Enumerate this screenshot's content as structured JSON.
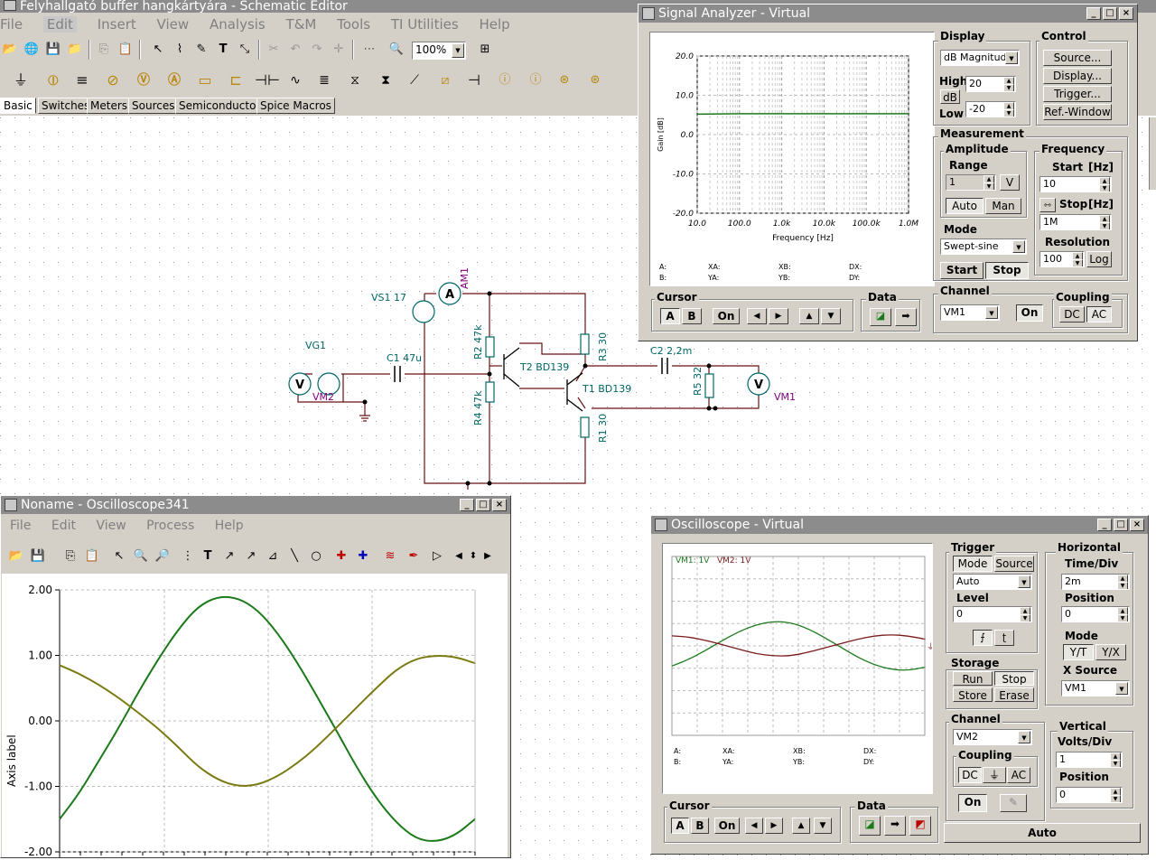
{
  "main": {
    "title": "Felyhallgató buffer hangkártyára - Schematic Editor",
    "menu": [
      "File",
      "Edit",
      "Insert",
      "View",
      "Analysis",
      "T&M",
      "Tools",
      "TI Utilities",
      "Help"
    ],
    "zoom": "100%",
    "tabs": [
      "Basic",
      "Switches",
      "Meters",
      "Sources",
      "Semiconductors",
      "Spice Macros"
    ]
  },
  "schematic": {
    "labels": {
      "vs1": "VS1 17",
      "am1": "AM1",
      "vg1": "VG1",
      "vm2": "VM2",
      "c1": "C1 47u",
      "r2": "R2 47k",
      "r4": "R4 47k",
      "t2": "T2 BD139",
      "t1": "T1 BD139",
      "r3": "R3 30",
      "r1": "R1 30",
      "c2": "C2 2,2m",
      "r5": "R5 32",
      "vm1": "VM1"
    }
  },
  "signal_analyzer": {
    "title": "Signal Analyzer - Virtual",
    "display_group": "Display",
    "display_mode": "dB Magnitude",
    "high_label": "High",
    "db_button": "dB",
    "low_label": "Low",
    "high_value": "20",
    "low_value": "-20",
    "control_group": "Control",
    "control_buttons": [
      "Source...",
      "Display...",
      "Trigger...",
      "Ref.-Window"
    ],
    "measurement_group": "Measurement",
    "amplitude_group": "Amplitude",
    "range_label": "Range",
    "range_value": "1",
    "range_unit": "V",
    "auto_btn": "Auto",
    "man_btn": "Man",
    "frequency_group": "Frequency",
    "start_label": "Start",
    "start_unit": "[Hz]",
    "start_value": "10",
    "stop_label": "Stop",
    "stop_unit": "[Hz]",
    "stop_value": "1M",
    "resolution_label": "Resolution",
    "resolution_value": "100",
    "log_btn": "Log",
    "mode_label": "Mode",
    "mode_value": "Swept-sine",
    "start_btn": "Start",
    "stop_btn": "Stop",
    "cursor_group": "Cursor",
    "cursor_buttons": [
      "A",
      "B",
      "On",
      "◀",
      "▶",
      "▲",
      "▼"
    ],
    "data_group": "Data",
    "channel_group": "Channel",
    "channel_value": "VM1",
    "channel_on": "On",
    "coupling_group": "Coupling",
    "dc_btn": "DC",
    "ac_btn": "AC",
    "readout": {
      "a": "A:",
      "b": "B:",
      "xa": "XA:",
      "ya": "YA:",
      "xb": "XB:",
      "yb": "YB:",
      "dx": "DX:",
      "dy": "DY:"
    }
  },
  "oscilloscope_virtual": {
    "title": "Oscilloscope - Virtual",
    "legend_vm1": "VM1: 1V",
    "legend_vm2": "VM2: 1V",
    "trigger_group": "Trigger",
    "mode_btn": "Mode",
    "source_btn": "Source",
    "trigger_mode": "Auto",
    "level_label": "Level",
    "level_value": "0",
    "horizontal_group": "Horizontal",
    "timediv_label": "Time/Div",
    "timediv_value": "2m",
    "position_label": "Position",
    "position_value": "0",
    "hmode_label": "Mode",
    "yt_btn": "Y/T",
    "yx_btn": "Y/X",
    "xsource_label": "X Source",
    "xsource_value": "VM1",
    "storage_group": "Storage",
    "run_btn": "Run",
    "stop_btn": "Stop",
    "store_btn": "Store",
    "erase_btn": "Erase",
    "channel_group": "Channel",
    "channel_value": "VM2",
    "coupling_group": "Coupling",
    "dc_btn": "DC",
    "gnd_btn": "⏚",
    "ac_btn": "AC",
    "on_btn": "On",
    "vertical_group": "Vertical",
    "voltsdiv_label": "Volts/Div",
    "voltsdiv_value": "1",
    "vposition_label": "Position",
    "vposition_value": "0",
    "cursor_group": "Cursor",
    "cursor_buttons": [
      "A",
      "B",
      "On",
      "◀",
      "▶",
      "▲",
      "▼"
    ],
    "data_group": "Data",
    "auto_btn": "Auto",
    "readout": {
      "a": "A:",
      "b": "B:",
      "xa": "XA:",
      "ya": "YA:",
      "xb": "XB:",
      "yb": "YB:",
      "dx": "DX:",
      "dy": "DY:"
    }
  },
  "oscilloscope341": {
    "title": "Noname - Oscilloscope341",
    "menu": [
      "File",
      "Edit",
      "View",
      "Process",
      "Help"
    ],
    "ylabel": "Axis label"
  },
  "colors": {
    "trace_green": "#1a7a1a",
    "trace_olive": "#7a7a10",
    "trace_maroon": "#7a1a1a",
    "schematic_label": "#006666",
    "meter_label": "#800080"
  },
  "chart_data": [
    {
      "type": "line",
      "title": "",
      "xlabel": "Frequency [Hz]",
      "ylabel": "Gain [dB]",
      "x_scale": "log",
      "x_ticks": [
        "10.0",
        "100.0",
        "1.0k",
        "10.0k",
        "100.0k",
        "1.0M"
      ],
      "y_ticks": [
        "20.0",
        "10.0",
        "0.0",
        "-10.0",
        "-20.0"
      ],
      "ylim": [
        -20,
        20
      ],
      "xlim": [
        10,
        1000000
      ],
      "series": [
        {
          "x": [
            10,
            100,
            1000,
            10000,
            100000,
            1000000
          ],
          "values": [
            5.2,
            5.3,
            5.3,
            5.3,
            5.3,
            5.3
          ]
        }
      ]
    },
    {
      "type": "line",
      "title": "",
      "xlabel": "",
      "ylabel": "Axis label",
      "y_ticks": [
        "2.00",
        "1.00",
        "0.00",
        "-1.00",
        "-2.00"
      ],
      "ylim": [
        -2,
        2
      ],
      "series": [
        {
          "values": [
            -1.5,
            -1.1,
            -0.6,
            -0.1,
            0.45,
            0.95,
            1.4,
            1.75,
            1.9,
            1.88,
            1.7,
            1.35,
            0.9,
            0.38,
            -0.15,
            -0.7,
            -1.18,
            -1.55,
            -1.8,
            -1.85,
            -1.75,
            -1.5
          ]
        },
        {
          "values": [
            0.85,
            0.72,
            0.55,
            0.35,
            0.12,
            -0.12,
            -0.4,
            -0.7,
            -0.9,
            -1.0,
            -0.98,
            -0.85,
            -0.65,
            -0.4,
            -0.1,
            0.2,
            0.5,
            0.78,
            0.95,
            1.0,
            0.98,
            0.88
          ]
        }
      ]
    },
    {
      "type": "line",
      "title": "",
      "series": [
        {
          "name": "VM1: 1V",
          "values": [
            -0.9,
            -0.6,
            -0.2,
            0.25,
            0.65,
            0.95,
            1.1,
            1.05,
            0.8,
            0.4,
            -0.05,
            -0.5,
            -0.85,
            -1.05,
            -1.1,
            -0.95
          ]
        },
        {
          "name": "VM2: 1V",
          "values": [
            0.45,
            0.4,
            0.25,
            0.05,
            -0.15,
            -0.35,
            -0.45,
            -0.45,
            -0.3,
            -0.1,
            0.1,
            0.3,
            0.45,
            0.5,
            0.45,
            0.3
          ]
        }
      ]
    }
  ]
}
